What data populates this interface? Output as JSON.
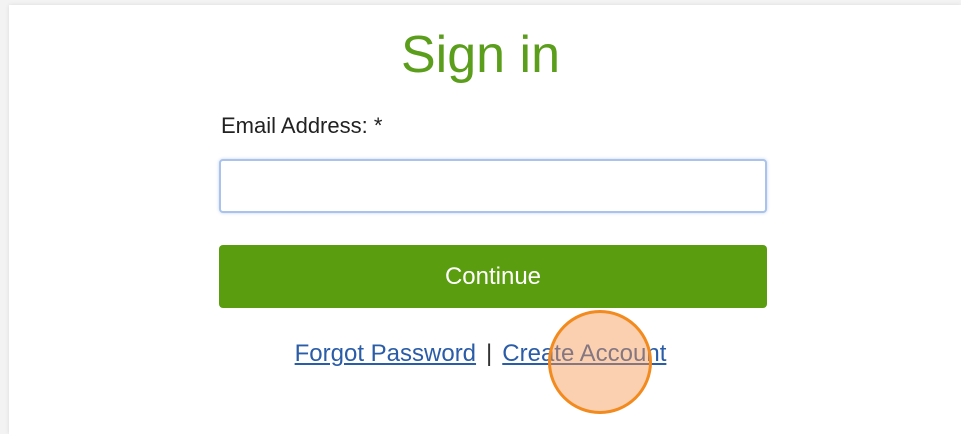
{
  "signin": {
    "title": "Sign in",
    "email_label": "Email Address: *",
    "email_value": "",
    "email_placeholder": "",
    "continue_label": "Continue",
    "forgot_password_label": "Forgot Password",
    "separator": "|",
    "create_account_label": "Create Account"
  },
  "colors": {
    "title": "#5b9e1c",
    "button": "#5a9e0f",
    "link": "#2a5ca8",
    "click_marker": "#f28a1e"
  }
}
